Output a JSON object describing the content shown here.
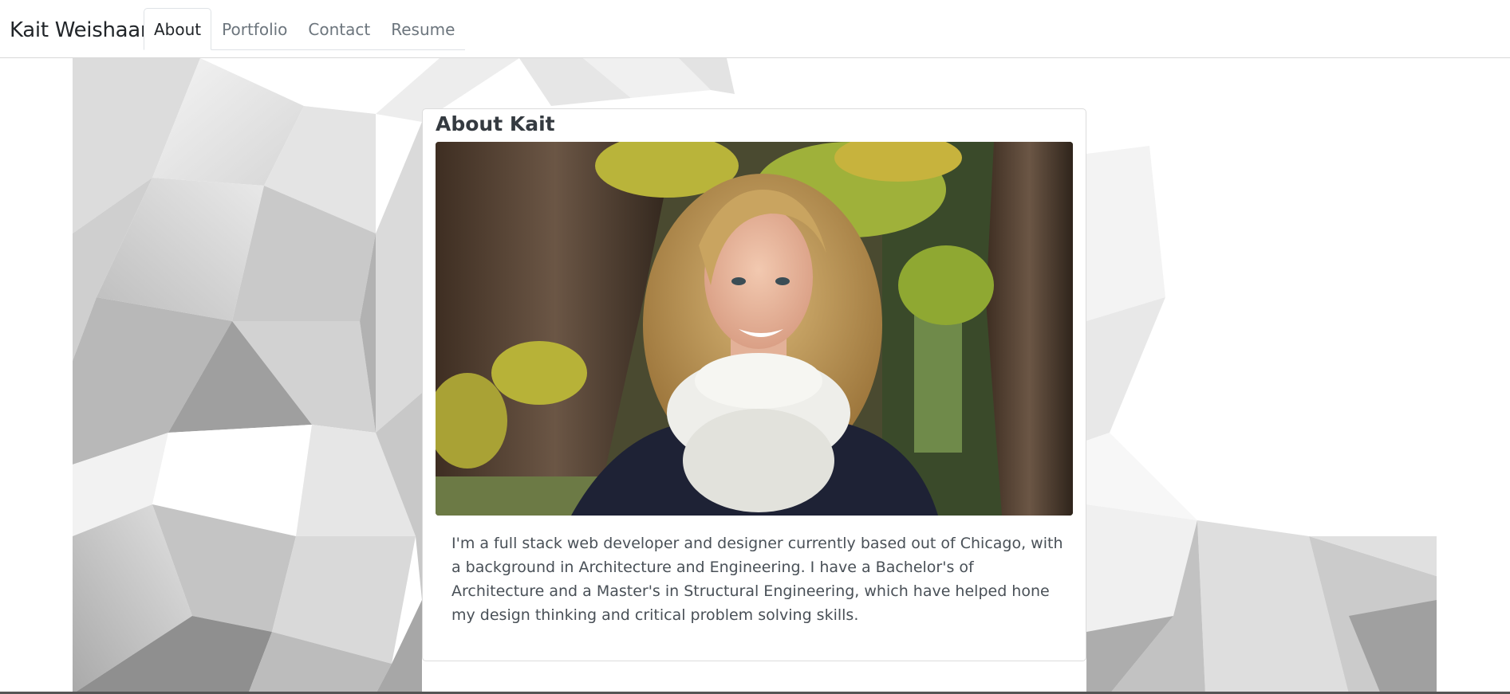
{
  "navbar": {
    "brand": "Kait Weishaar",
    "tabs": [
      {
        "label": "About",
        "active": true
      },
      {
        "label": "Portfolio",
        "active": false
      },
      {
        "label": "Contact",
        "active": false
      },
      {
        "label": "Resume",
        "active": false
      }
    ]
  },
  "about": {
    "title": "About Kait",
    "photo_icon": "portrait-photo",
    "bio": "I'm a full stack web developer and designer currently based out of Chicago, with a background in Architecture and Engineering. I have a Bachelor's of Architecture and a Master's in Structural Engineering, which have helped hone my design thinking and critical problem solving skills."
  },
  "colors": {
    "text_dark": "#212529",
    "text_muted": "#6c757d",
    "border": "#dee2e6"
  }
}
